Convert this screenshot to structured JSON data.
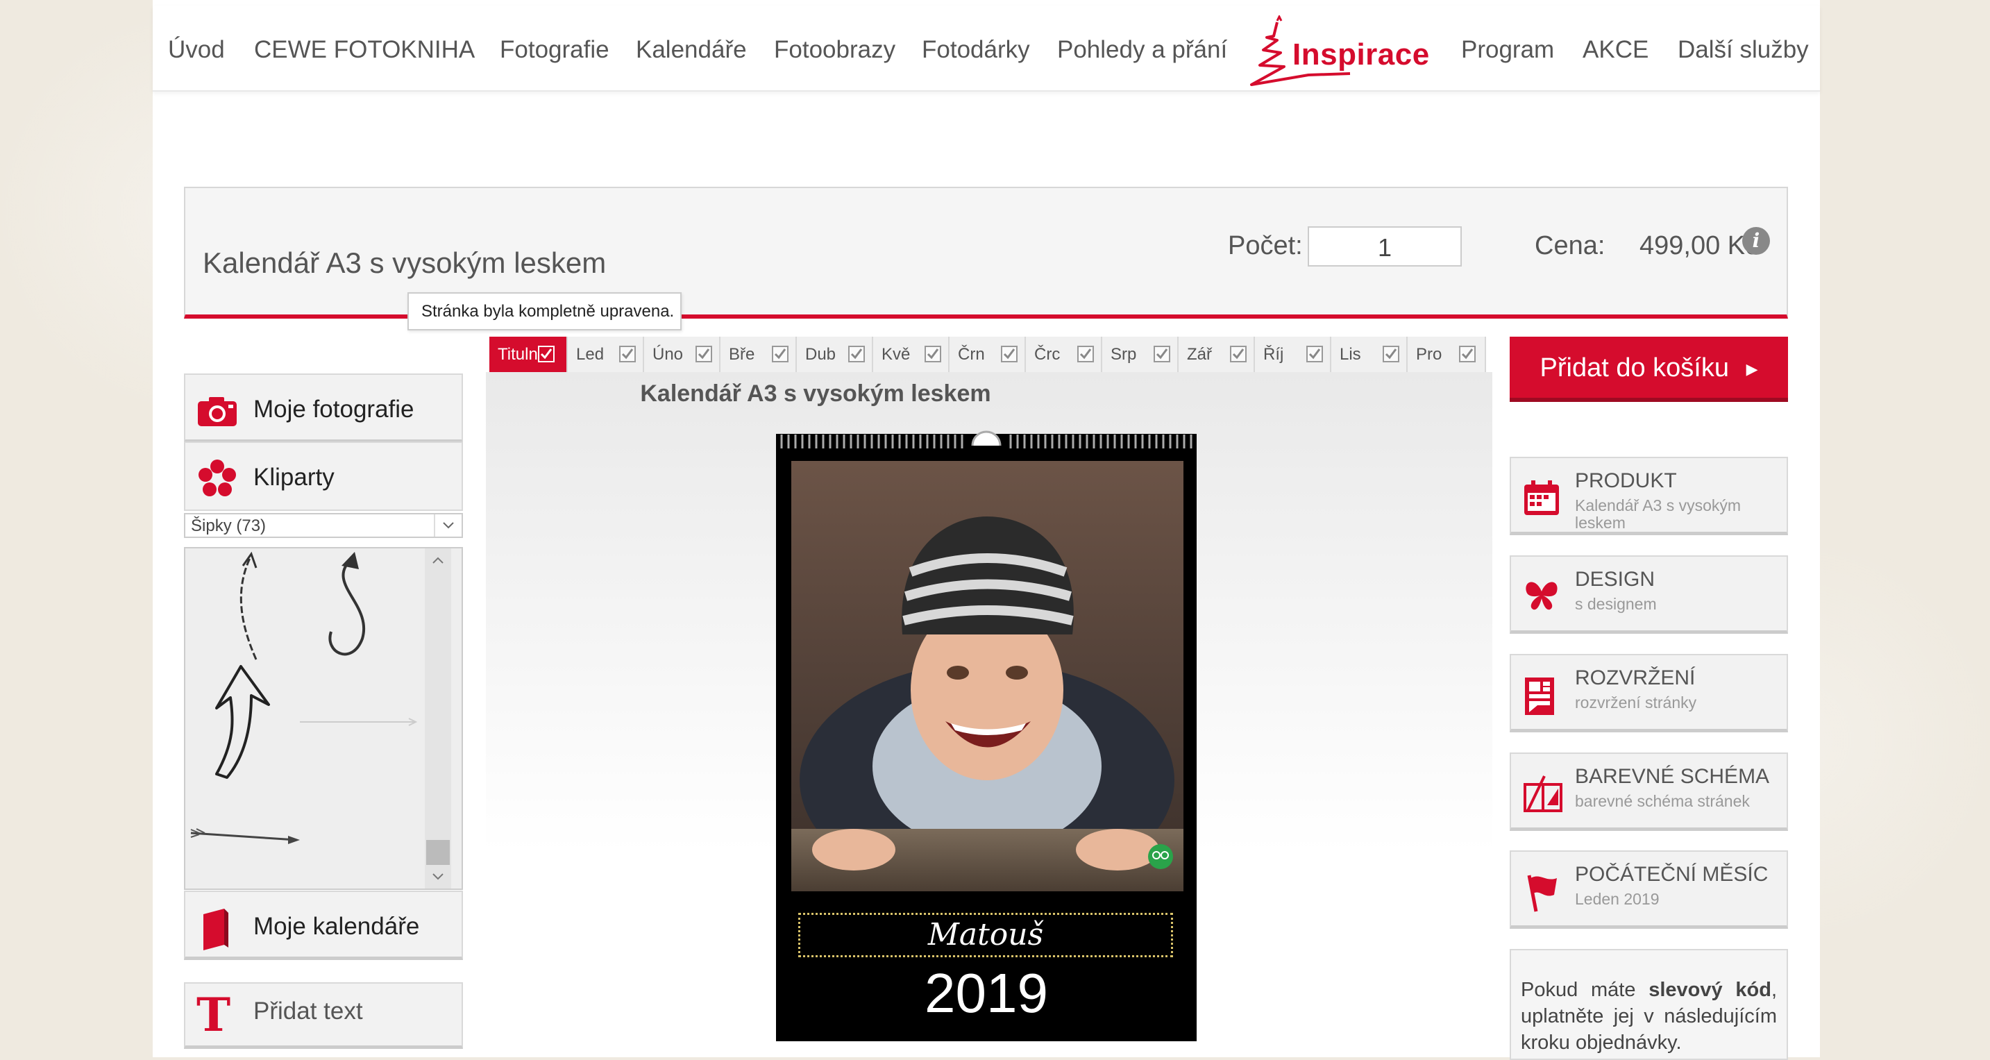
{
  "nav": {
    "items": [
      "Úvod",
      "CEWE FOTOKNIHA",
      "Fotografie",
      "Kalendáře",
      "Fotoobrazy",
      "Fotodárky",
      "Pohledy a přání"
    ],
    "logo_label": "Inspirace",
    "items_right": [
      "Program",
      "AKCE",
      "Další služby"
    ]
  },
  "product": {
    "title": "Kalendář A3 s vysokým leskem",
    "qty_label": "Počet:",
    "qty_value": "1",
    "price_label": "Cena:",
    "price_value": "499,00 Kč",
    "info_icon": "i"
  },
  "tooltip": "Stránka byla kompletně upravena.",
  "left_panel": {
    "my_photos": "Moje fotografie",
    "cliparts": "Kliparty",
    "clipart_select": "Šipky (73)",
    "my_calendars": "Moje kalendáře",
    "add_text": "Přidat text"
  },
  "tabs": [
    "Titulní",
    "Led",
    "Úno",
    "Bře",
    "Dub",
    "Kvě",
    "Črn",
    "Črc",
    "Srp",
    "Zář",
    "Říj",
    "Lis",
    "Pro"
  ],
  "canvas": {
    "title": "Kalendář A3 s vysokým leskem",
    "name_text": "Matouš",
    "year": "2019"
  },
  "cart_button": "Přidat do košíku",
  "right_panel": {
    "product_title": "PRODUKT",
    "product_sub": "Kalendář A3 s vysokým leskem",
    "design_title": "DESIGN",
    "design_sub": "s designem",
    "layout_title": "ROZVRŽENÍ",
    "layout_sub": "rozvržení stránky",
    "scheme_title": "BAREVNÉ SCHÉMA",
    "scheme_sub": "barevné schéma stránek",
    "month_title": "POČÁTEČNÍ MĚSÍC",
    "month_sub": "Leden 2019"
  },
  "coupon": {
    "before": "Pokud máte ",
    "bold": "slevový kód",
    "after": ", uplatněte jej v následujícím kroku objednávky."
  },
  "colors": {
    "accent": "#d50c2d",
    "panel": "#f2f2f2"
  }
}
